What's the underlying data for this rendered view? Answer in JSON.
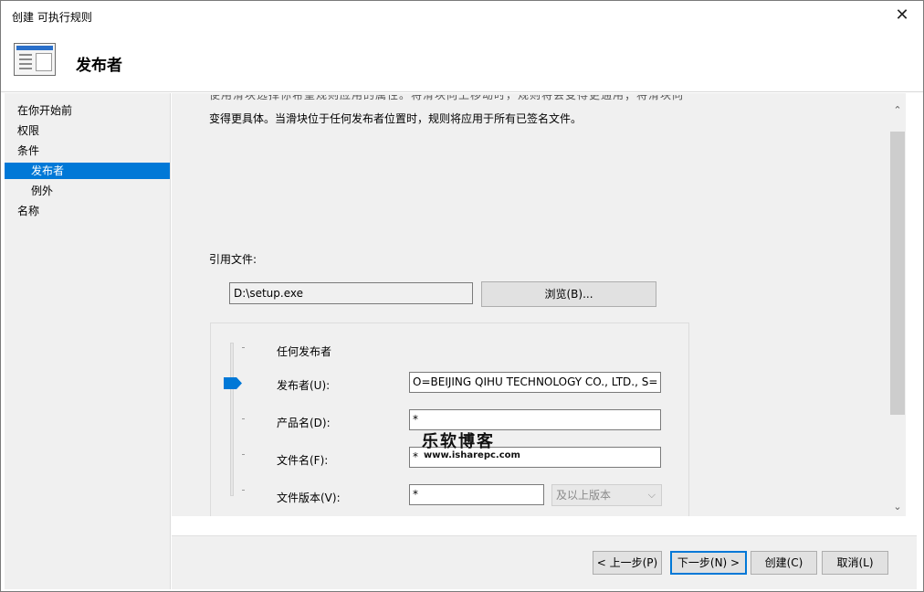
{
  "window": {
    "title": "创建 可执行规则",
    "close_glyph": "✕"
  },
  "header": {
    "title": "发布者"
  },
  "sidebar": {
    "items": [
      {
        "label": "在你开始前"
      },
      {
        "label": "权限"
      },
      {
        "label": "条件"
      },
      {
        "label": "发布者"
      },
      {
        "label": "例外"
      },
      {
        "label": "名称"
      }
    ]
  },
  "content": {
    "description_cut_top": "使用滑块选择你希望规则应用的属性。将滑块向上移动时，规则将会变得更通用；将滑块向下移动时，规则将",
    "description": "变得更具体。当滑块位于任何发布者位置时，规则将应用于所有已签名文件。",
    "reference_file_label": "引用文件:",
    "reference_file_value": "D:\\setup.exe",
    "browse_label": "浏览(B)...",
    "levels": {
      "any_publisher": "任何发布者",
      "publisher_label": "发布者(U):",
      "publisher_value": "O=BEIJING QIHU TECHNOLOGY CO., LTD., S=",
      "product_label": "产品名(D):",
      "product_value": "*",
      "filename_label": "文件名(F):",
      "filename_value": "*",
      "version_label": "文件版本(V):",
      "version_value": "*",
      "version_scope": "及以上版本",
      "slider_position": "publisher"
    }
  },
  "watermark": {
    "title": "乐软博客",
    "url": "www.isharepc.com"
  },
  "footer": {
    "back": "< 上一步(P)",
    "next": "下一步(N) >",
    "create": "创建(C)",
    "cancel": "取消(L)"
  },
  "colors": {
    "selection": "#0078d7",
    "panel": "#f0f0f0",
    "button": "#e1e1e1"
  }
}
